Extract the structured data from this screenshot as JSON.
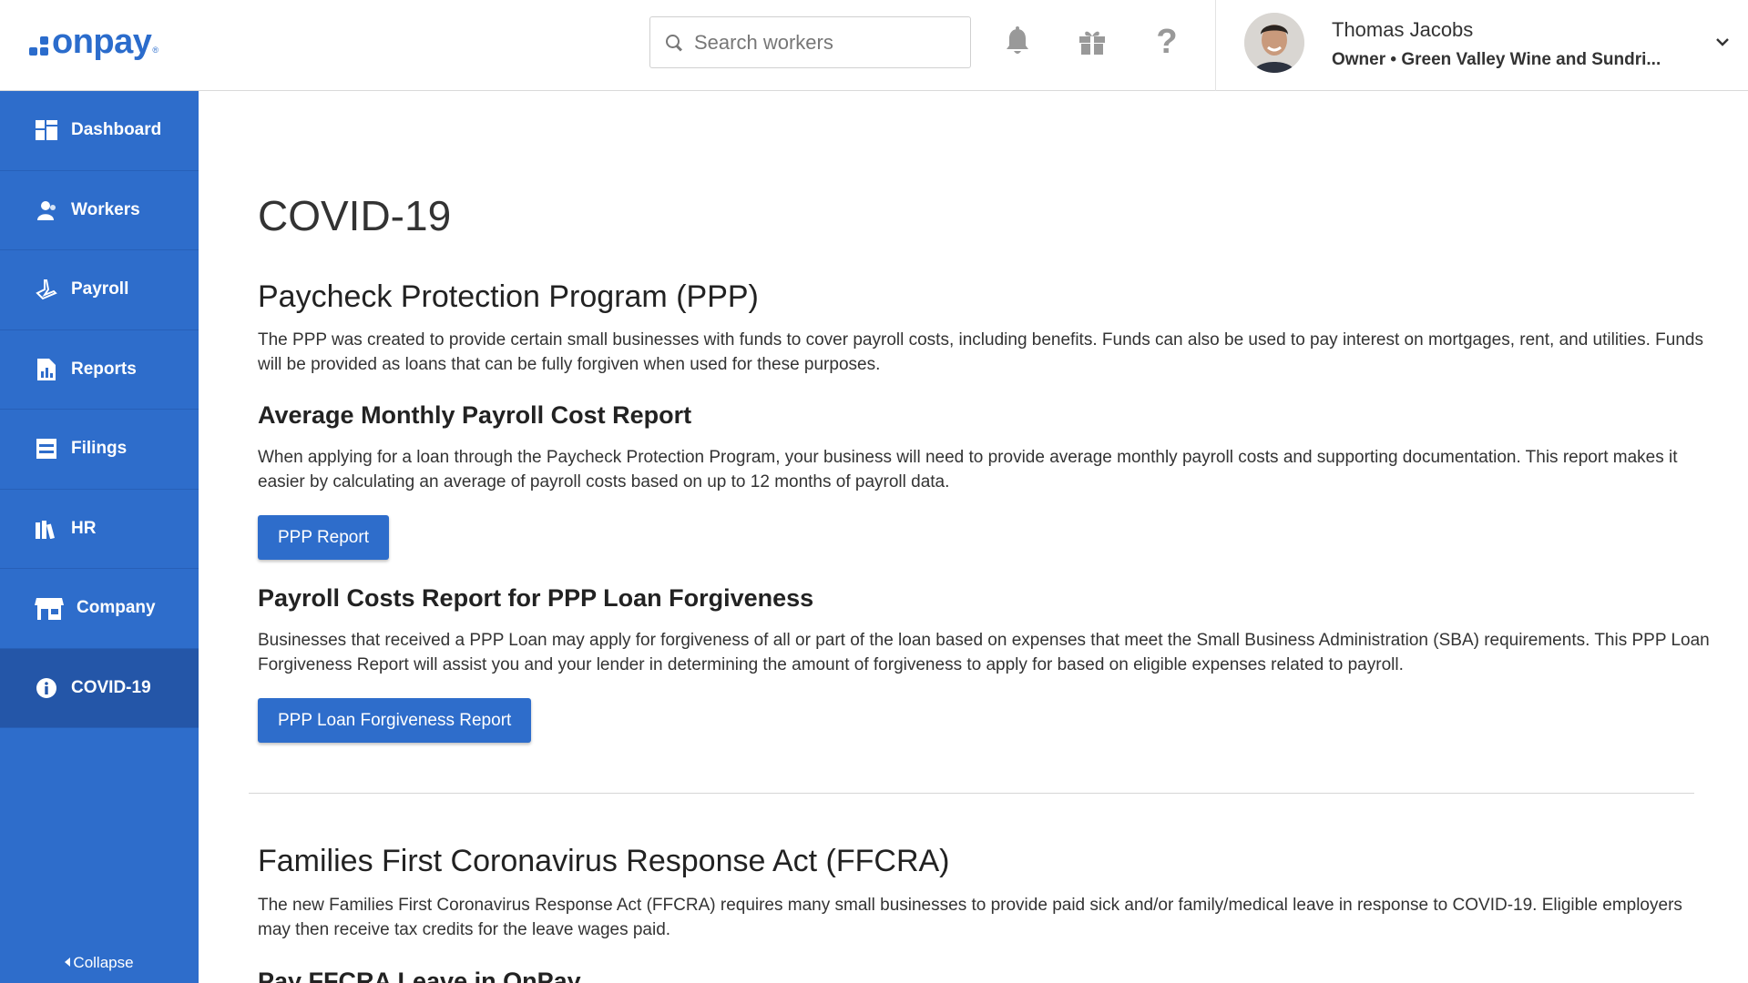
{
  "header": {
    "logo_text": "onpay",
    "logo_reg": "®",
    "search_placeholder": "Search workers",
    "help_glyph": "?",
    "user": {
      "name": "Thomas Jacobs",
      "role": "Owner • Green Valley Wine and Sundri..."
    }
  },
  "sidebar": {
    "items": [
      {
        "label": "Dashboard",
        "icon": "dashboard-icon"
      },
      {
        "label": "Workers",
        "icon": "workers-icon"
      },
      {
        "label": "Payroll",
        "icon": "payroll-icon"
      },
      {
        "label": "Reports",
        "icon": "reports-icon"
      },
      {
        "label": "Filings",
        "icon": "filings-icon"
      },
      {
        "label": "HR",
        "icon": "hr-icon"
      },
      {
        "label": "Company",
        "icon": "company-icon"
      },
      {
        "label": "COVID-19",
        "icon": "info-icon",
        "active": true
      }
    ],
    "collapse_label": "Collapse"
  },
  "main": {
    "title": "COVID-19",
    "ppp": {
      "heading": "Paycheck Protection Program (PPP)",
      "description": "The PPP was created to provide certain small businesses with funds to cover payroll costs, including benefits. Funds can also be used to pay interest on mortgages, rent, and utilities. Funds will be provided as loans that can be fully forgiven when used for these purposes."
    },
    "avg_report": {
      "heading": "Average Monthly Payroll Cost Report",
      "description": "When applying for a loan through the Paycheck Protection Program, your business will need to provide average monthly payroll costs and supporting documentation. This report makes it easier by calculating an average of payroll costs based on up to 12 months of payroll data.",
      "button": "PPP Report"
    },
    "forgiveness_report": {
      "heading": "Payroll Costs Report for PPP Loan Forgiveness",
      "description": "Businesses that received a PPP Loan may apply for forgiveness of all or part of the loan based on expenses that meet the Small Business Administration (SBA) requirements. This PPP Loan Forgiveness Report will assist you and your lender in determining the amount of forgiveness to apply for based on eligible expenses related to payroll.",
      "button": "PPP Loan Forgiveness Report"
    },
    "ffcra": {
      "heading": "Families First Coronavirus Response Act (FFCRA)",
      "description": "The new Families First Coronavirus Response Act (FFCRA) requires many small businesses to provide paid sick and/or family/medical leave in response to COVID-19. Eligible employers may then receive tax credits for the leave wages paid.",
      "subheading": "Pay FFCRA Leave in OnPay"
    }
  },
  "colors": {
    "brand": "#2e6dcb",
    "sidebar_active": "#2456a8",
    "text": "#333333"
  }
}
